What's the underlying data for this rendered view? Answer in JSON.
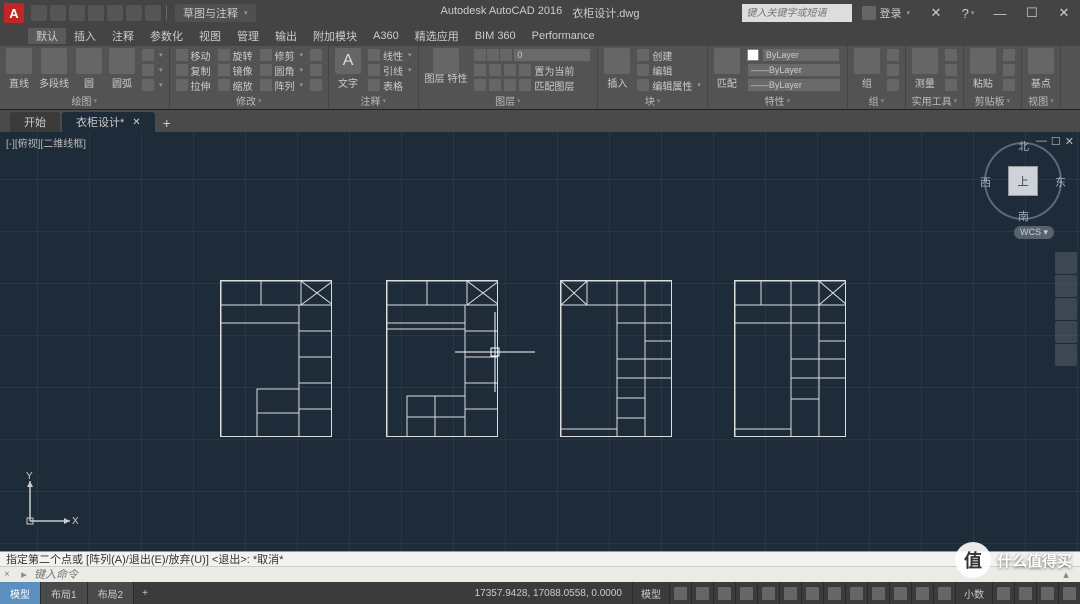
{
  "app": {
    "icon_letter": "A",
    "name": "Autodesk AutoCAD 2016",
    "document": "衣柜设计.dwg",
    "workspace": "草图与注释"
  },
  "menu": [
    "默认",
    "插入",
    "注释",
    "参数化",
    "视图",
    "管理",
    "输出",
    "附加模块",
    "A360",
    "精选应用",
    "BIM 360",
    "Performance"
  ],
  "search": {
    "placeholder": "键入关键字或短语"
  },
  "signin": {
    "label": "登录"
  },
  "window": {
    "min": "—",
    "max": "☐",
    "close": "✕"
  },
  "ribbon": {
    "draw": {
      "title": "绘图",
      "big": [
        {
          "label": "直线"
        },
        {
          "label": "多段线"
        },
        {
          "label": "圆"
        },
        {
          "label": "圆弧"
        }
      ]
    },
    "modify": {
      "title": "修改",
      "rows": [
        [
          {
            "label": "移动"
          },
          {
            "label": "旋转"
          },
          {
            "label": "修剪"
          }
        ],
        [
          {
            "label": "复制"
          },
          {
            "label": "镜像"
          },
          {
            "label": "圆角"
          }
        ],
        [
          {
            "label": "拉伸"
          },
          {
            "label": "缩放"
          },
          {
            "label": "阵列"
          }
        ]
      ]
    },
    "annotation": {
      "title": "注释",
      "big": [
        {
          "label": "文字"
        }
      ],
      "rows": [
        [
          {
            "label": "线性"
          }
        ],
        [
          {
            "label": "引线"
          }
        ],
        [
          {
            "label": "表格"
          }
        ]
      ]
    },
    "layers": {
      "title": "图层",
      "big_label": "图层\n特性",
      "combo": "0",
      "rows": [
        [
          ""
        ],
        [
          ""
        ],
        [
          ""
        ]
      ]
    },
    "block": {
      "title": "块",
      "big": [
        {
          "label": "插入"
        }
      ],
      "rows": [
        [
          {
            "label": "创建"
          }
        ],
        [
          {
            "label": "编辑"
          }
        ],
        [
          {
            "label": "编辑属性"
          }
        ]
      ]
    },
    "properties": {
      "title": "特性",
      "big_label": "特性",
      "bylayer": "ByLayer",
      "match": "匹配"
    },
    "groups": {
      "title": "组",
      "big_label": "组"
    },
    "utilities": {
      "title": "实用工具",
      "big_label": "测量"
    },
    "clipboard": {
      "title": "剪贴板",
      "big_label": "粘贴"
    },
    "view": {
      "title": "视图",
      "big_label": "基点"
    }
  },
  "filetabs": {
    "start": "开始",
    "active": "衣柜设计*"
  },
  "viewport": {
    "label": "[-][俯视][二维线框]"
  },
  "viewcube": {
    "face": "上",
    "n": "北",
    "s": "南",
    "e": "东",
    "w": "西",
    "wcs": "WCS"
  },
  "ucs": {
    "x": "X",
    "y": "Y"
  },
  "command": {
    "history": "指定第二个点或 [阵列(A)/退出(E)/放弃(U)] <退出>: *取消*",
    "handle": "×",
    "prompt_placeholder": "键入命令"
  },
  "status": {
    "model": "模型",
    "layout1": "布局1",
    "layout2": "布局2",
    "coords": "17357.9428, 17088.0558, 0.0000",
    "model_btn": "模型",
    "scale": "小数"
  },
  "watermark": {
    "circle": "值",
    "text": "什么值得买"
  }
}
